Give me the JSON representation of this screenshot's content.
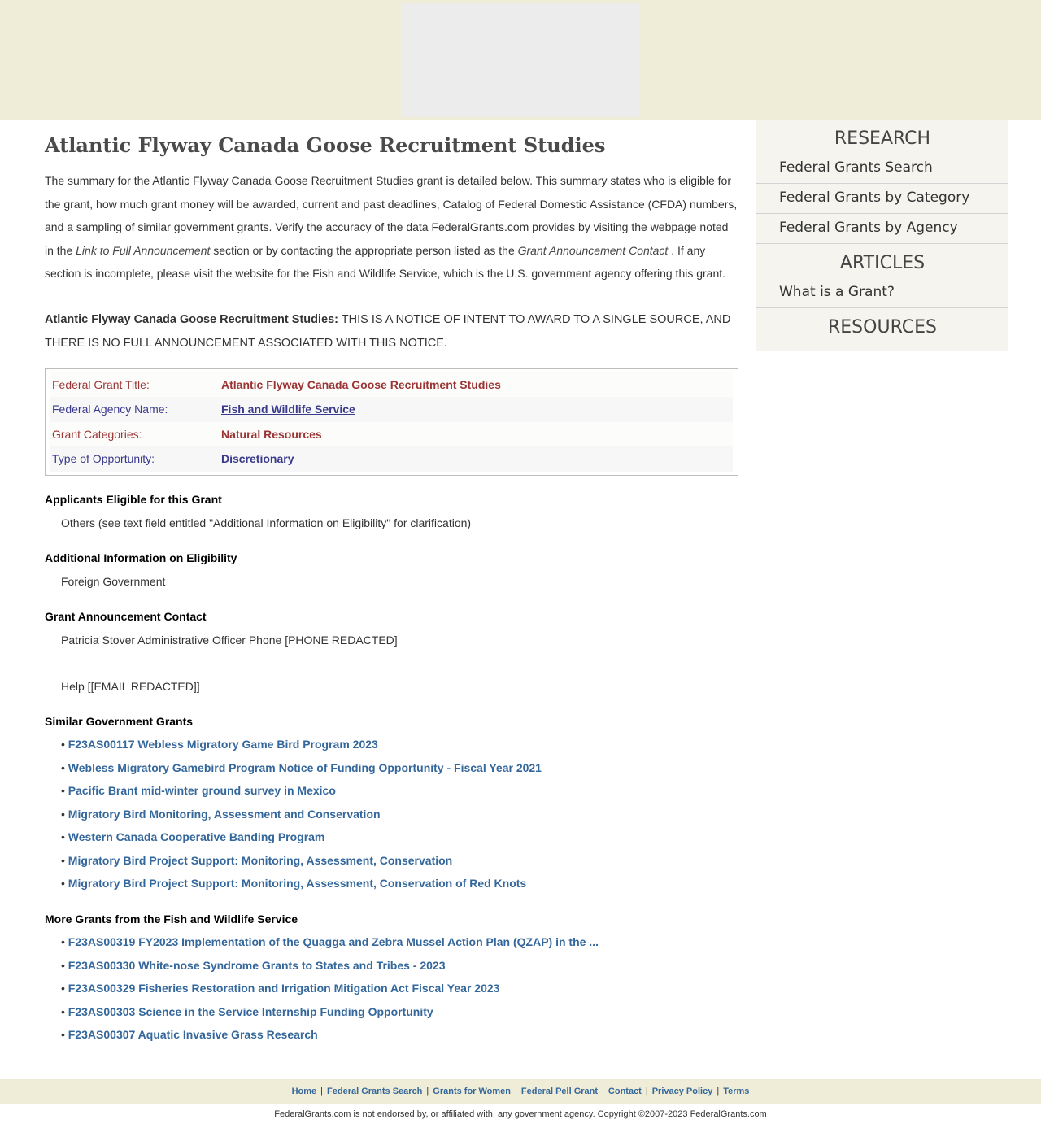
{
  "page": {
    "title": "Atlantic Flyway Canada Goose Recruitment Studies",
    "intro_1": "The summary for the Atlantic Flyway Canada Goose Recruitment Studies grant is detailed below. This summary states who is eligible for the grant, how much grant money will be awarded, current and past deadlines, Catalog of Federal Domestic Assistance (CFDA) numbers, and a sampling of similar government grants. Verify the accuracy of the data FederalGrants.com provides by visiting the webpage noted in the",
    "intro_link_label": "Link to Full Announcement",
    "intro_2": "section or by contacting the appropriate person listed as the",
    "intro_contact_label": "Grant Announcement Contact",
    "intro_3": ". If any section is incomplete, please visit the website for the Fish and Wildlife Service, which is the U.S. government agency offering this grant.",
    "notice_title": "Atlantic Flyway Canada Goose Recruitment Studies:",
    "notice_text": "THIS IS A NOTICE OF INTENT TO AWARD TO A SINGLE SOURCE, AND THERE IS NO FULL ANNOUNCEMENT ASSOCIATED WITH THIS NOTICE."
  },
  "info_table": {
    "grant_title_label": "Federal Grant Title:",
    "grant_title_value": "Atlantic Flyway Canada Goose Recruitment Studies",
    "agency_label": "Federal Agency Name:",
    "agency_value": "Fish and Wildlife Service",
    "categories_label": "Grant Categories:",
    "categories_value": "Natural Resources",
    "type_label": "Type of Opportunity:",
    "type_value": "Discretionary"
  },
  "sections": {
    "eligible_heading": "Applicants Eligible for this Grant",
    "eligible_text": "Others (see text field entitled \"Additional Information on Eligibility\" for clarification)",
    "additional_heading": "Additional Information on Eligibility",
    "additional_text": "Foreign Government",
    "contact_heading": "Grant Announcement Contact",
    "contact_text": "Patricia Stover Administrative Officer Phone [PHONE REDACTED]",
    "contact_help": "Help [[EMAIL REDACTED]]",
    "similar_heading": "Similar Government Grants",
    "similar": [
      "F23AS00117 Webless Migratory Game Bird Program 2023",
      "Webless Migratory Gamebird Program Notice of Funding Opportunity - Fiscal Year 2021",
      "Pacific Brant mid-winter ground survey in Mexico",
      "Migratory Bird Monitoring, Assessment and Conservation",
      "Western Canada Cooperative Banding Program",
      "Migratory Bird Project Support: Monitoring, Assessment, Conservation",
      "Migratory Bird Project Support: Monitoring, Assessment, Conservation of Red Knots"
    ],
    "more_heading": "More Grants from the Fish and Wildlife Service",
    "more": [
      "F23AS00319 FY2023 Implementation of the Quagga and Zebra Mussel Action Plan (QZAP) in the ...",
      "F23AS00330 White-nose Syndrome Grants to States and Tribes - 2023",
      "F23AS00329 Fisheries Restoration and Irrigation Mitigation Act Fiscal Year 2023",
      "F23AS00303 Science in the Service Internship Funding Opportunity",
      "F23AS00307 Aquatic Invasive Grass Research"
    ],
    "bullet": "•"
  },
  "sidebar": {
    "research_heading": "RESEARCH",
    "research_items": [
      "Federal Grants Search",
      "Federal Grants by Category",
      "Federal Grants by Agency"
    ],
    "articles_heading": "ARTICLES",
    "articles_items": [
      "What is a Grant?"
    ],
    "resources_heading": "RESOURCES"
  },
  "footer": {
    "links": [
      "Home",
      "Federal Grants Search",
      "Grants for Women",
      "Federal Pell Grant",
      "Contact",
      "Privacy Policy",
      "Terms"
    ],
    "separator": "|",
    "copyright": "FederalGrants.com is not endorsed by, or affiliated with, any government agency. Copyright ©2007-2023 FederalGrants.com"
  }
}
